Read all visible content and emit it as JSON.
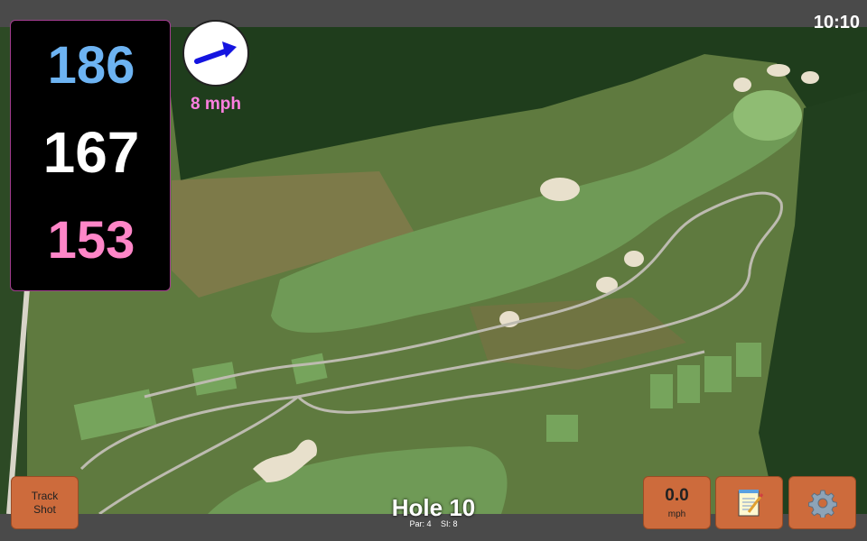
{
  "status": {
    "time": "10:10"
  },
  "yardages": {
    "back": "186",
    "middle": "167",
    "front": "153"
  },
  "wind": {
    "speed": "8 mph",
    "direction_icon": "arrow-up-right-icon"
  },
  "buttons": {
    "track_shot_line1": "Track",
    "track_shot_line2": "Shot",
    "notes_icon": "notepad-icon",
    "settings_icon": "gear-icon"
  },
  "speed": {
    "value": "0.0",
    "unit": "mph"
  },
  "hole": {
    "title": "Hole 10",
    "par": "Par: 4",
    "si": "SI: 8"
  },
  "colors": {
    "back": "#6db3f2",
    "middle": "#ffffff",
    "front": "#ff86c8",
    "button": "#cd6b3c",
    "wind_text": "#ff7fe0"
  }
}
